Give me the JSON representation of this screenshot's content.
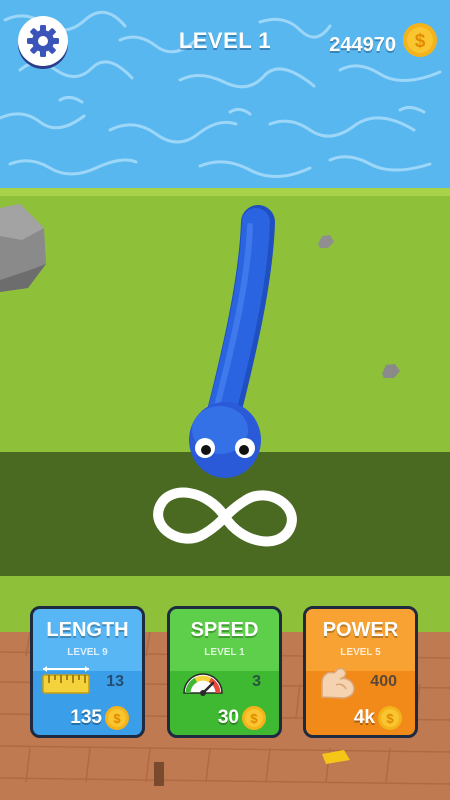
{
  "top_bar": {
    "settings_icon": "gear-icon",
    "level_label": "LEVEL 1",
    "coin_count": "244970",
    "coin_icon": "dollar-coin-icon"
  },
  "hint": {
    "gesture_icon": "infinity-icon"
  },
  "upgrades": [
    {
      "title": "LENGTH",
      "level": "LEVEL 9",
      "value": "13",
      "price": "135",
      "icon": "ruler-icon",
      "color": "#3a9fe8"
    },
    {
      "title": "SPEED",
      "level": "LEVEL 1",
      "value": "3",
      "price": "30",
      "icon": "speedometer-icon",
      "color": "#3fb932"
    },
    {
      "title": "POWER",
      "level": "LEVEL 5",
      "value": "400",
      "price": "4k",
      "icon": "flexed-arm-icon",
      "color": "#f28a1a"
    }
  ],
  "colors": {
    "water": "#58b7ee",
    "grass": "#8fc03a",
    "dirt": "#c07a52",
    "snake": "#2a64e0"
  }
}
